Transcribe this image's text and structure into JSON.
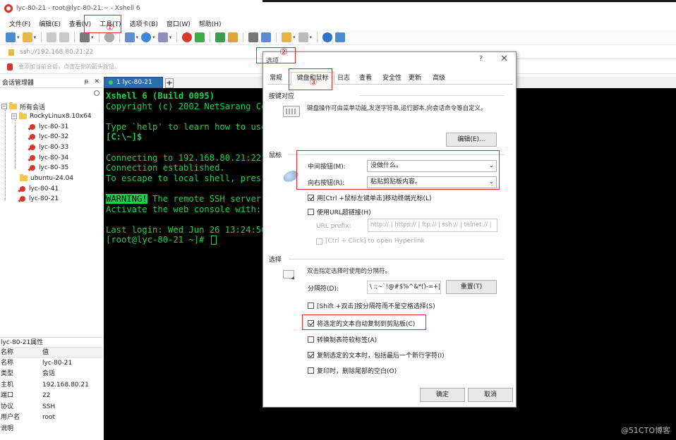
{
  "window": {
    "title": "lyc-80-21 - root@lyc-80-21:~ - Xshell 6"
  },
  "menu": [
    "文件(F)",
    "编辑(E)",
    "查看(V)",
    "工具(T)",
    "选项卡(B)",
    "窗口(W)",
    "帮助(H)"
  ],
  "address": "ssh://192.168.80.21:22",
  "hint": "要添加当前会话，点击左侧的箭头按钮。",
  "session_manager": {
    "title": "会话管理器",
    "controls": [
      "ᵽ",
      "✕"
    ],
    "tree": {
      "root": "所有会话",
      "folder1": "RockyLinux8.10x64",
      "items": [
        "lyc-80-31",
        "lyc-80-32",
        "lyc-80-33",
        "lyc-80-34",
        "lyc-80-35"
      ],
      "folder2": "ubuntu-24.04",
      "item_41": "lyc-80-41",
      "item_21": "lyc-80-21"
    }
  },
  "properties": {
    "title": "lyc-80-21属性",
    "col_name": "名称",
    "col_value": "值",
    "rows": [
      {
        "k": "名称",
        "v": "lyc-80-21"
      },
      {
        "k": "类型",
        "v": "会话"
      },
      {
        "k": "主机",
        "v": "192.168.80.21"
      },
      {
        "k": "端口",
        "v": "22"
      },
      {
        "k": "协议",
        "v": "SSH"
      },
      {
        "k": "用户名",
        "v": "root"
      },
      {
        "k": "说明",
        "v": ""
      }
    ]
  },
  "terminal": {
    "tab_label": "1 lyc-80-21",
    "lines": [
      "Xshell 6 (Build 0095)",
      "Copyright (c) 2002 NetSarang Co",
      "",
      "Type `help' to learn how to use",
      "[C:\\~]$",
      "",
      "Connecting to 192.168.80.21:22",
      "Connection established.",
      "To escape to local shell, pres",
      "",
      " The remote SSH server",
      "Activate the web console with:",
      "",
      "Last login: Wed Jun 26 13:24:50",
      "[root@lyc-80-21 ~]# "
    ],
    "warning_tag": "WARNING!"
  },
  "dialog": {
    "title": "选项",
    "help": "?",
    "close": "✕",
    "tabs": [
      "常规",
      "键盘和鼠标",
      "日志",
      "查看",
      "安全性",
      "更新",
      "高级"
    ],
    "keymap": {
      "section": "按键对应",
      "desc": "键盘操作可由菜单功能,发送字符串,运行脚本,向会话命令等自定义。",
      "edit_button": "编辑(E)..."
    },
    "mouse": {
      "section": "鼠标",
      "middle_label": "中间按钮(M):",
      "middle_value": "没做什么。",
      "right_label": "向右按钮(R):",
      "right_value": "粘贴剪贴板内容。",
      "ctrl_drag": "用[Ctrl +鼠标左键单击]移动终端光标(L)",
      "use_url": "使用URL超链接(H)",
      "url_prefix_label": "URL prefix:",
      "url_prefix_value": "http:// | https:// | ftp:// | ssh:// | telnet:// |",
      "ctrl_click": "[Ctrl + Click] to open Hyperlink"
    },
    "selection": {
      "section": "选择",
      "desc": "双击指定选择时使用的分隔符。",
      "delim_label": "分隔符(D):",
      "delim_value": "\\ :;~`!@#$%^&*()-=+|[]{}",
      "reset_button": "重置(T)",
      "shift_dbl": "[Shift +双击]按分隔符而不是空格选择(S)",
      "auto_copy": "将选定的文本自动复制到剪贴板(C)",
      "tab_to_space": "转换制表符软标签(A)",
      "copy_newline": "复制选定的文本时，包括最后一个新行字符(I)",
      "trim_trailing": "复印时，删除尾部的空白(O)"
    },
    "ok": "确定",
    "cancel": "取消"
  },
  "annotations": [
    "①",
    "②",
    "③"
  ],
  "watermark": "@51CTO博客",
  "colors": {
    "terminal_fg": "#19d14b",
    "terminal_bg": "#000000",
    "annotation": "#e0282e",
    "tab_active": "#2b6cb0"
  }
}
